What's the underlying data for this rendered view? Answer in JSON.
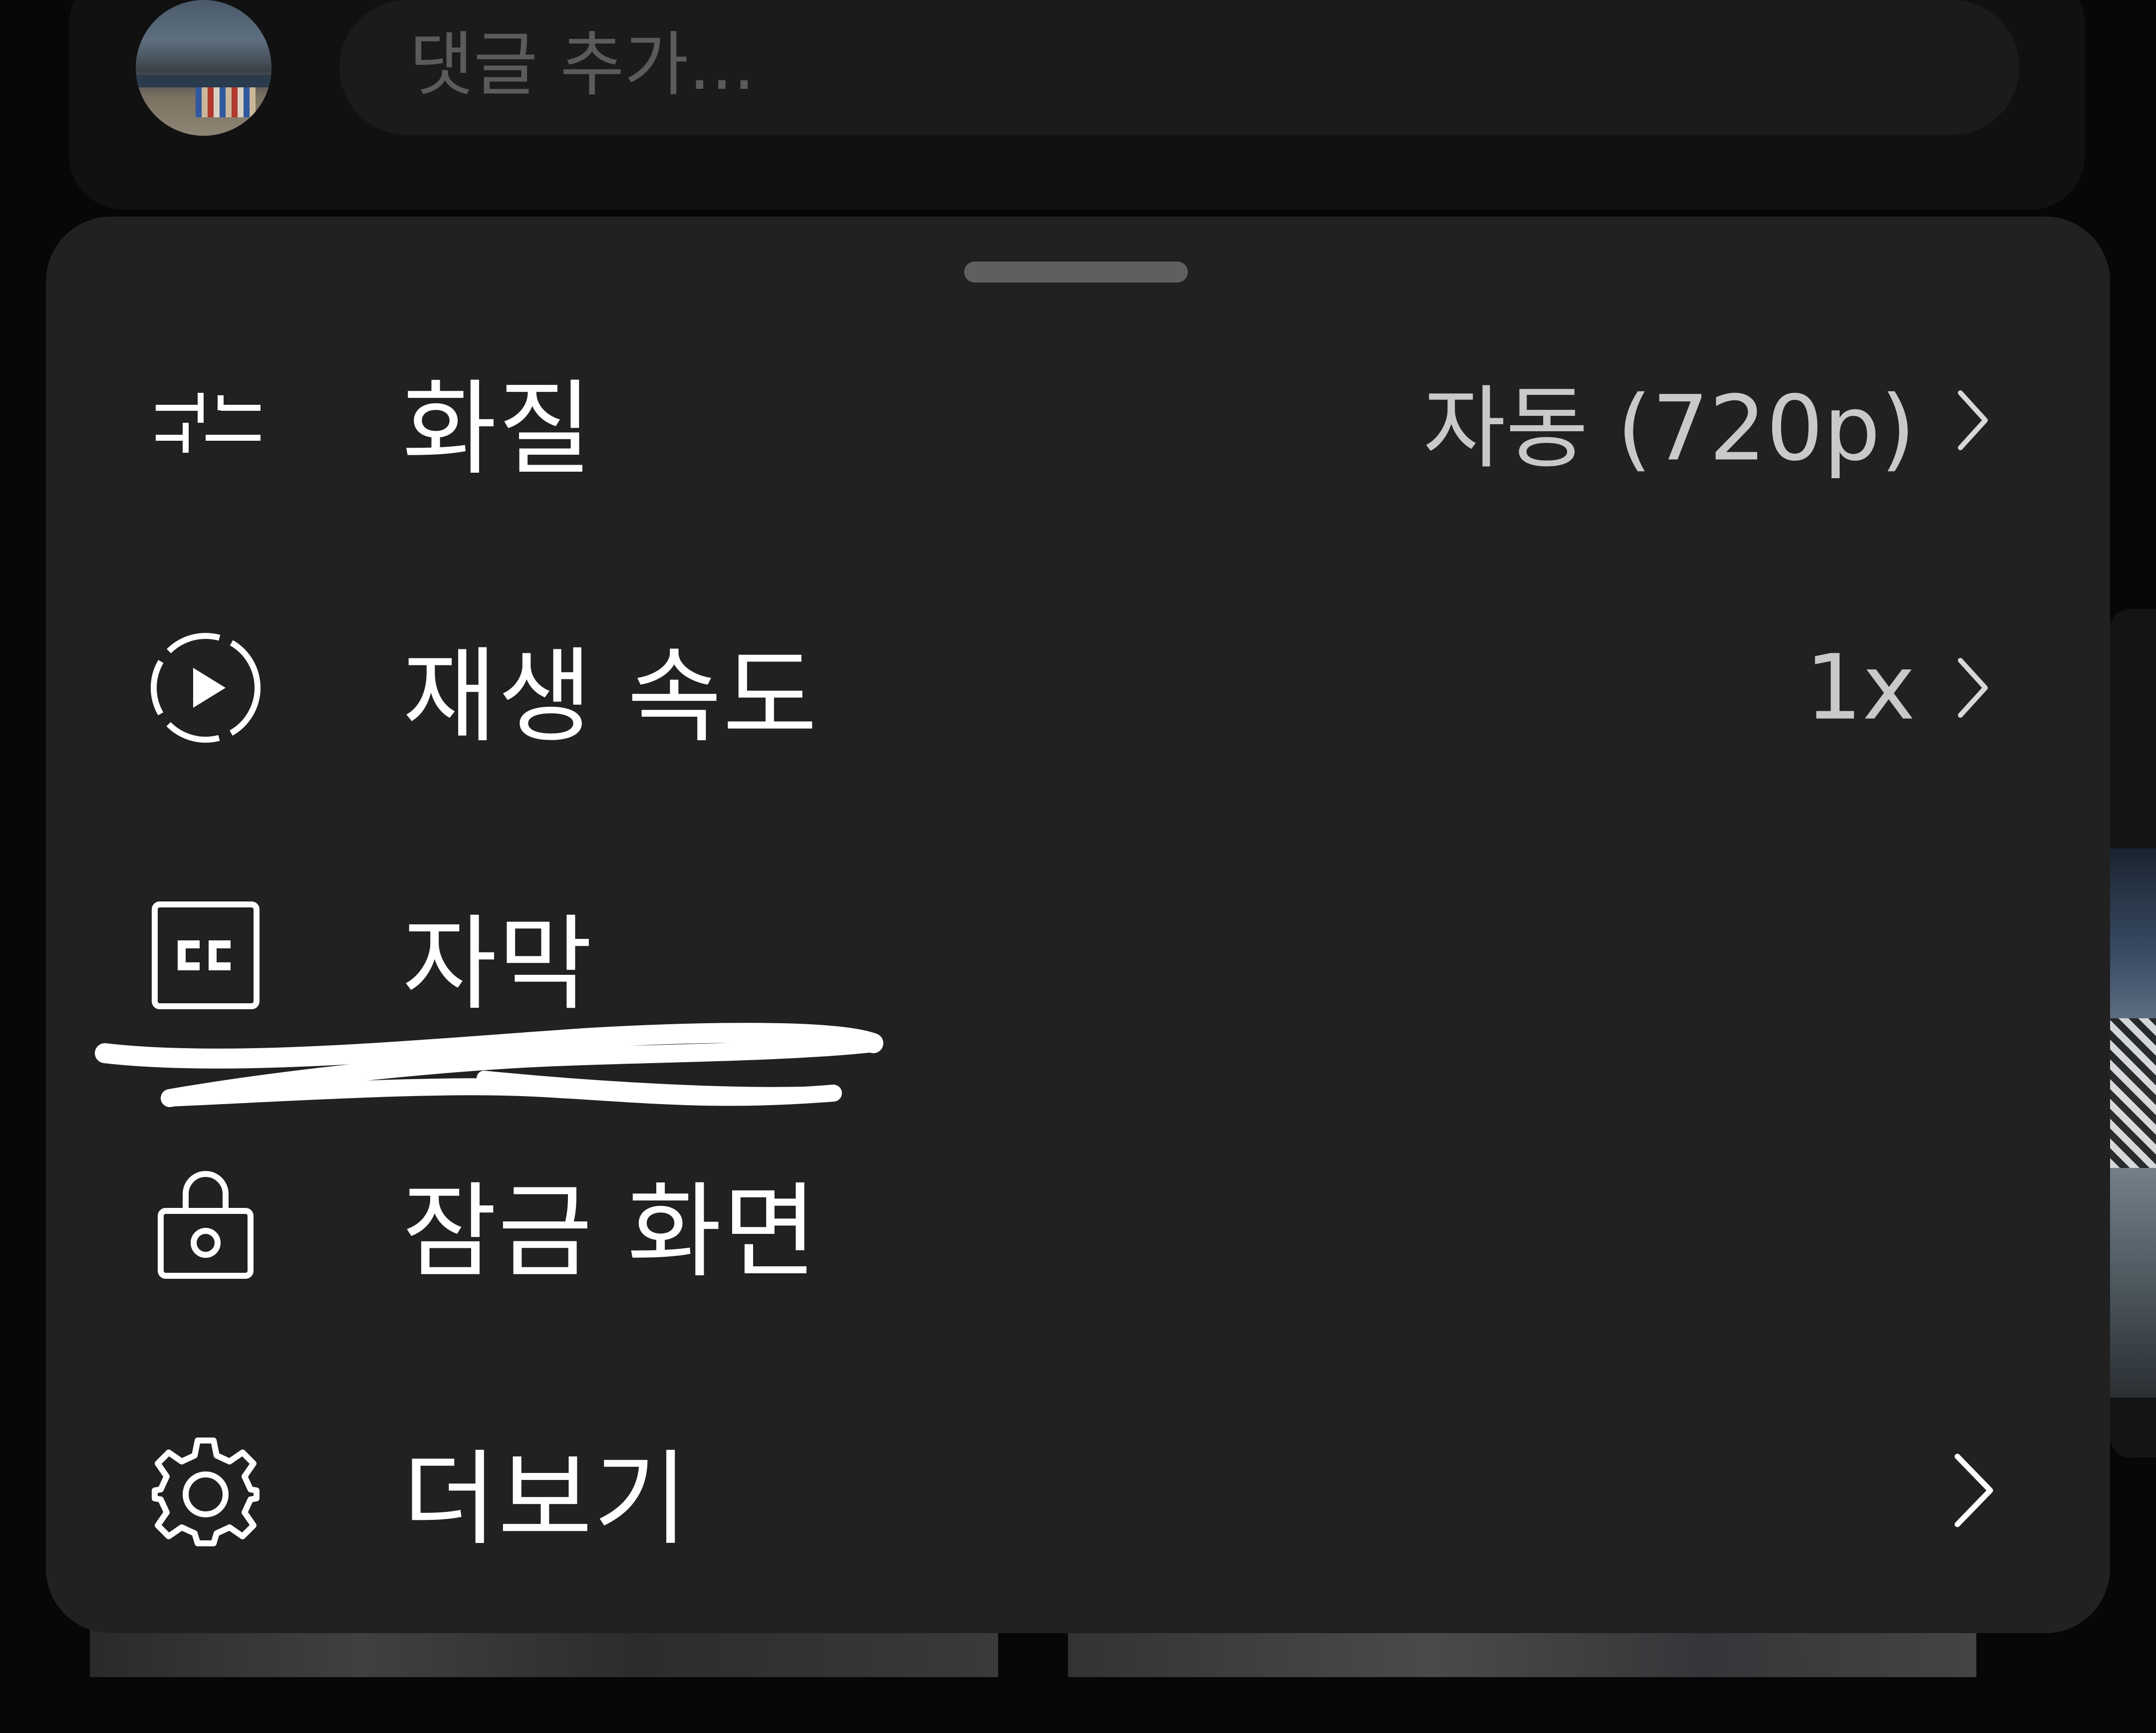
{
  "comment": {
    "placeholder": "댓글 추가..."
  },
  "sheet": {
    "items": [
      {
        "id": "quality",
        "icon": "sliders-icon",
        "label": "화질",
        "value": "자동 (720p)",
        "has_chevron": true
      },
      {
        "id": "speed",
        "icon": "playback-speed-icon",
        "label": "재생 속도",
        "value": "1x",
        "has_chevron": true
      },
      {
        "id": "captions",
        "icon": "cc-icon",
        "label": "자막",
        "value": "",
        "has_chevron": false
      },
      {
        "id": "lock",
        "icon": "lock-icon",
        "label": "잠금 화면",
        "value": "",
        "has_chevron": false
      },
      {
        "id": "more",
        "icon": "gear-icon",
        "label": "더보기",
        "value": "",
        "has_chevron": true
      }
    ]
  },
  "colors": {
    "sheet_bg": "#212121",
    "page_bg": "#070707",
    "label_text": "#ffffff",
    "value_text": "#c9c9c9",
    "handle": "#5f5f5f"
  }
}
